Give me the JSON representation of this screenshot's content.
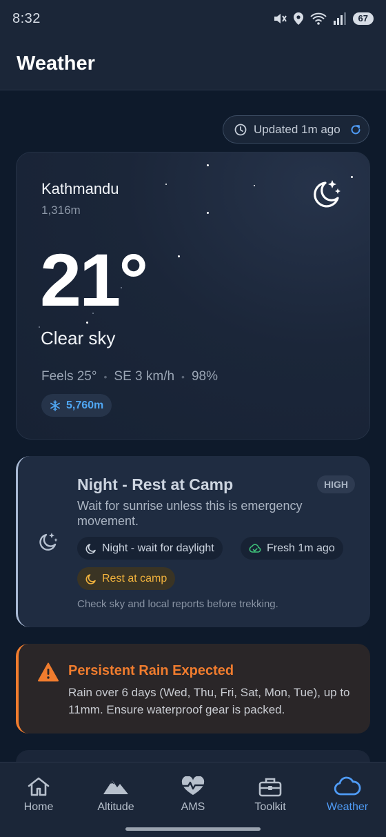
{
  "status": {
    "time": "8:32",
    "battery": "67"
  },
  "appbar": {
    "title": "Weather"
  },
  "updated": {
    "label": "Updated 1m ago"
  },
  "hero": {
    "city": "Kathmandu",
    "elevation": "1,316m",
    "temperature": "21°",
    "condition": "Clear sky",
    "feels": "Feels 25°",
    "wind": "SE 3 km/h",
    "humidity": "98%",
    "snowline": "5,760m",
    "icon": "moon-stars-icon"
  },
  "advice": {
    "title": "Night - Rest at Camp",
    "badge": "HIGH",
    "text": "Wait for sunrise unless this is emergency movement.",
    "chips": [
      {
        "label": "Night - wait for daylight",
        "icon": "moon-icon"
      },
      {
        "label": "Fresh 1m ago",
        "icon": "cloud-check-icon"
      },
      {
        "label": "Rest at camp",
        "icon": "moon-icon"
      }
    ],
    "note": "Check sky and local reports before trekking."
  },
  "alert": {
    "title": "Persistent Rain Expected",
    "text": "Rain over 6 days (Wed, Thu, Fri, Sat, Mon, Tue), up to 11mm. Ensure waterproof gear is packed.",
    "icon": "warning-icon"
  },
  "nav": {
    "items": [
      {
        "label": "Home",
        "icon": "home-icon"
      },
      {
        "label": "Altitude",
        "icon": "mountain-icon"
      },
      {
        "label": "AMS",
        "icon": "heartbeat-icon"
      },
      {
        "label": "Toolkit",
        "icon": "toolbox-icon"
      },
      {
        "label": "Weather",
        "icon": "cloud-icon"
      }
    ],
    "active": "Weather"
  },
  "colors": {
    "accent": "#4f9bf5",
    "warning": "#f07c2e",
    "amber": "#f2b33d",
    "background": "#0e1a2b"
  }
}
